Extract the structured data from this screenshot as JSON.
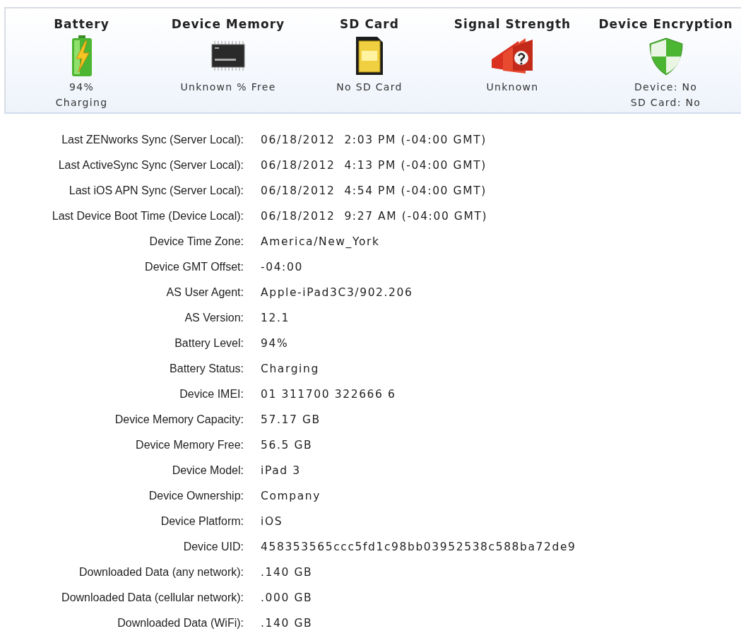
{
  "status_tiles": [
    {
      "kind": "battery",
      "title": "Battery",
      "lines": [
        "94%",
        "Charging"
      ]
    },
    {
      "kind": "memory",
      "title": "Device Memory",
      "lines": [
        "Unknown % Free"
      ]
    },
    {
      "kind": "sdcard",
      "title": "SD Card",
      "lines": [
        "No SD Card"
      ]
    },
    {
      "kind": "signal",
      "title": "Signal Strength",
      "lines": [
        "Unknown"
      ]
    },
    {
      "kind": "encryption",
      "title": "Device Encryption",
      "lines": [
        "Device: No",
        "SD Card: No"
      ]
    }
  ],
  "details": [
    {
      "label": "Last ZENworks Sync (Server Local):",
      "value": "06/18/2012  2:03 PM (-04:00 GMT)"
    },
    {
      "label": "Last ActiveSync Sync (Server Local):",
      "value": "06/18/2012  4:13 PM (-04:00 GMT)"
    },
    {
      "label": "Last iOS APN Sync (Server Local):",
      "value": "06/18/2012  4:54 PM (-04:00 GMT)"
    },
    {
      "label": "Last Device Boot Time (Device Local):",
      "value": "06/18/2012  9:27 AM (-04:00 GMT)"
    },
    {
      "label": "Device Time Zone:",
      "value": "America/New_York"
    },
    {
      "label": "Device GMT Offset:",
      "value": "-04:00"
    },
    {
      "label": "AS User Agent:",
      "value": "Apple-iPad3C3/902.206"
    },
    {
      "label": "AS Version:",
      "value": "12.1"
    },
    {
      "label": "Battery Level:",
      "value": "94%"
    },
    {
      "label": "Battery Status:",
      "value": "Charging"
    },
    {
      "label": "Device IMEI:",
      "value": "01 311700 322666 6"
    },
    {
      "label": "Device Memory Capacity:",
      "value": "57.17 GB"
    },
    {
      "label": "Device Memory Free:",
      "value": "56.5 GB"
    },
    {
      "label": "Device Model:",
      "value": "iPad 3"
    },
    {
      "label": "Device Ownership:",
      "value": "Company"
    },
    {
      "label": "Device Platform:",
      "value": "iOS"
    },
    {
      "label": "Device UID:",
      "value": "458353565ccc5fd1c98bb03952538c588ba72de9"
    },
    {
      "label": "Downloaded Data (any network):",
      "value": ".140 GB"
    },
    {
      "label": "Downloaded Data (cellular network):",
      "value": ".000 GB"
    },
    {
      "label": "Downloaded Data (WiFi):",
      "value": ".140 GB"
    }
  ]
}
